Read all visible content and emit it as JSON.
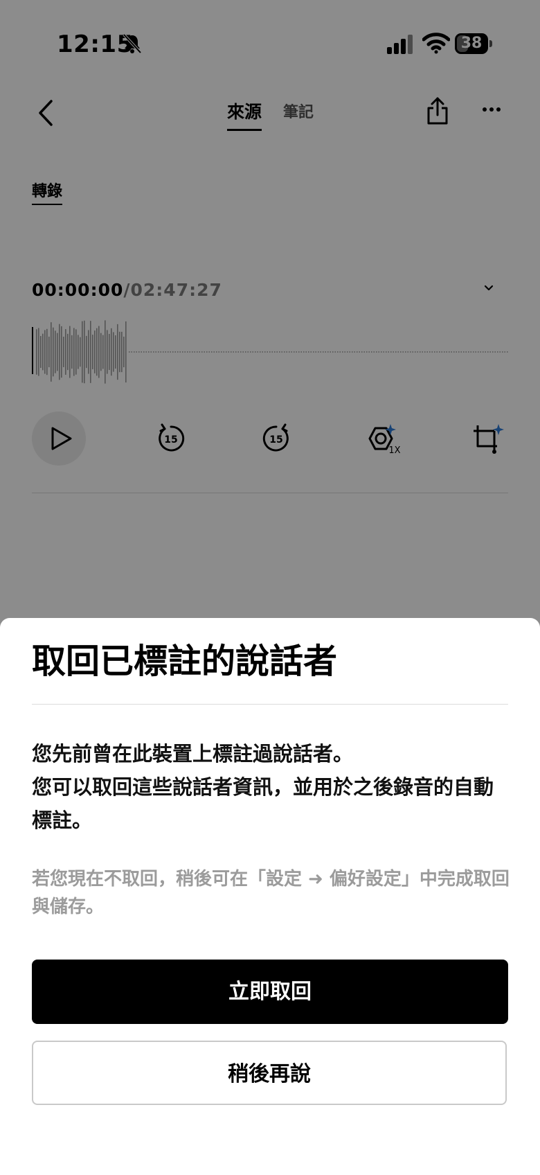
{
  "status_bar": {
    "time": "12:15",
    "battery_level": "38",
    "battery_fraction": 0.38,
    "icons": [
      "bell-slash-icon",
      "cellular-signal-icon",
      "wifi-icon",
      "battery-icon"
    ]
  },
  "nav": {
    "tabs": [
      {
        "label": "來源",
        "active": true
      },
      {
        "label": "筆記",
        "active": false
      }
    ],
    "icons": [
      "chevron-left-icon",
      "share-icon",
      "more-icon"
    ]
  },
  "subtab": {
    "label": "轉錄"
  },
  "player": {
    "current_time": "00:00:00",
    "separator": "/",
    "total_time": "02:47:27",
    "progress": 0.0,
    "speed_label": "1X",
    "skip_seconds": "15",
    "icons": [
      "chevron-down-icon",
      "play-icon",
      "rewind-15-icon",
      "forward-15-icon",
      "speed-sparkle-icon",
      "crop-sparkle-icon"
    ]
  },
  "sheet": {
    "title": "取回已標註的說話者",
    "body_line1": "您先前曾在此裝置上標註過說話者。",
    "body_line2": "您可以取回這些說話者資訊，並用於之後錄音的自動標註。",
    "note": "若您現在不取回，稍後可在「設定 ➜ 偏好設定」中完成取回與儲存。",
    "primary_label": "立即取回",
    "secondary_label": "稍後再說"
  },
  "colors": {
    "scrim": "#000000",
    "primary_button": "#000000",
    "accent_sparkle": "#2e7bd6"
  }
}
